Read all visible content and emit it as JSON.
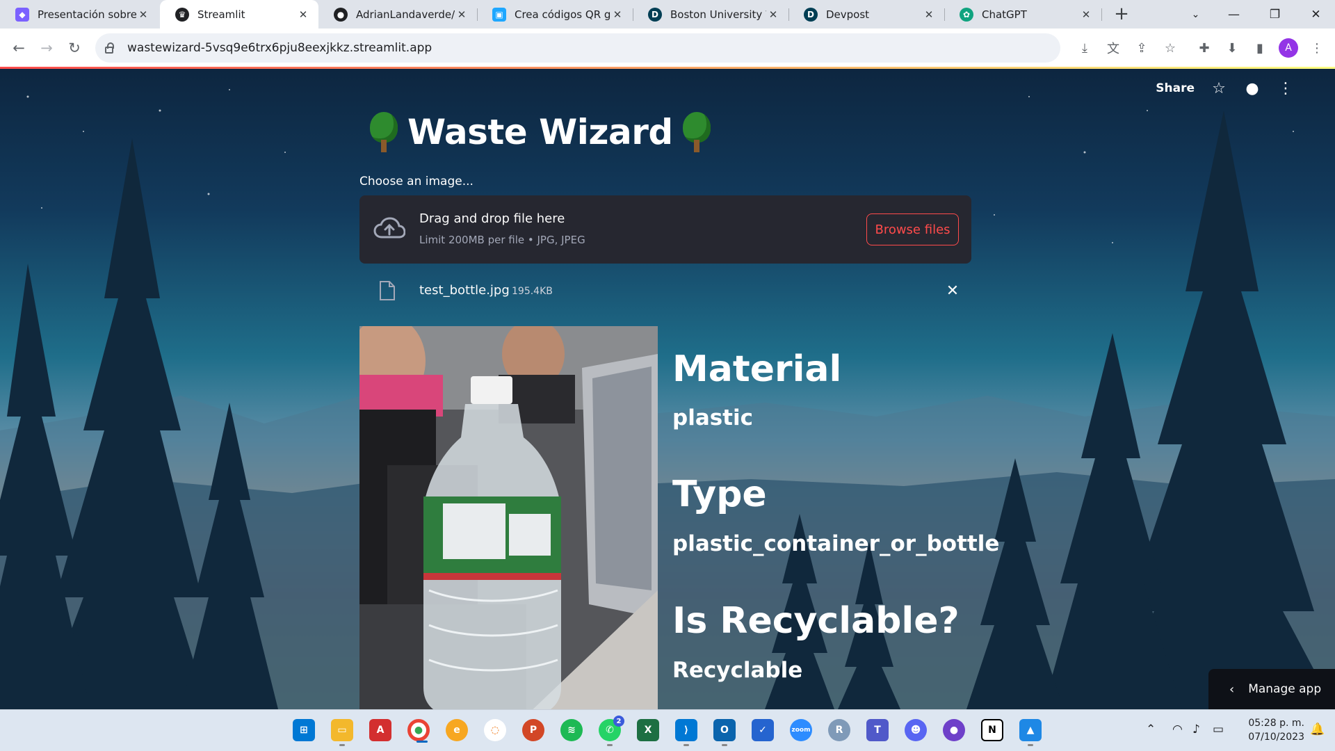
{
  "browser": {
    "tabs": [
      {
        "title": "Presentación sobre R",
        "favicon": "presentation-icon",
        "color": "#7b61ff",
        "active": false
      },
      {
        "title": "Streamlit",
        "favicon": "streamlit-crown-icon",
        "color": "#202124",
        "active": true
      },
      {
        "title": "AdrianLandaverde/W",
        "favicon": "github-icon",
        "color": "#202124",
        "active": false
      },
      {
        "title": "Crea códigos QR grat",
        "favicon": "qr-icon",
        "color": "#1ea7ff",
        "active": false
      },
      {
        "title": "Boston University We",
        "favicon": "devpost-icon",
        "color": "#003e54",
        "active": false
      },
      {
        "title": "Devpost",
        "favicon": "devpost-icon",
        "color": "#003e54",
        "active": false
      },
      {
        "title": "ChatGPT",
        "favicon": "chatgpt-icon",
        "color": "#10a37f",
        "active": false
      }
    ],
    "url": "wastewizard-5vsq9e6trx6pju8eexjkkz.streamlit.app",
    "profile_initial": "A"
  },
  "app": {
    "toolbar": {
      "share_label": "Share"
    },
    "title": "Waste Wizard",
    "uploader": {
      "label": "Choose an image...",
      "drop_title": "Drag and drop file here",
      "drop_subtitle": "Limit 200MB per file • JPG, JPEG",
      "browse_label": "Browse files"
    },
    "file": {
      "name": "test_bottle.jpg",
      "size": "195.4KB"
    },
    "results": [
      {
        "heading": "Material",
        "value": "plastic"
      },
      {
        "heading": "Type",
        "value": "plastic_container_or_bottle"
      },
      {
        "heading": "Is Recyclable?",
        "value": "Recyclable"
      }
    ],
    "manage_label": "Manage app"
  },
  "taskbar": {
    "apps": [
      "windows-start-icon",
      "file-explorer-icon",
      "acrobat-icon",
      "chrome-icon",
      "edge-canary-icon",
      "anaconda-icon",
      "powerpoint-icon",
      "spotify-icon",
      "whatsapp-icon",
      "excel-icon",
      "vscode-icon",
      "outlook-icon",
      "todo-icon",
      "zoom-icon",
      "r-icon",
      "teams-icon",
      "discord-icon",
      "github-desktop-icon",
      "notion-icon",
      "photos-icon"
    ],
    "whatsapp_badge": "2",
    "time": "05:28 p. m.",
    "date": "07/10/2023"
  }
}
